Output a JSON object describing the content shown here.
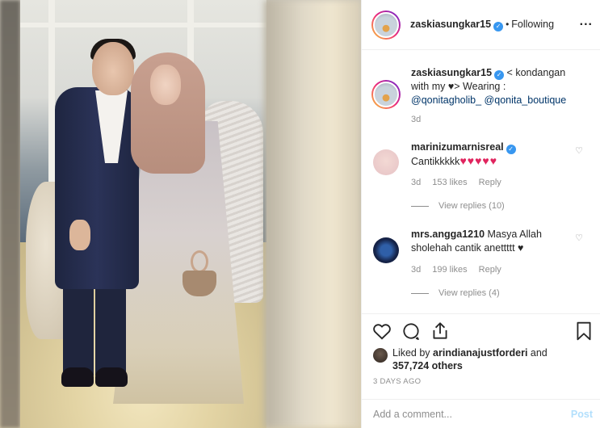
{
  "header": {
    "username": "zaskiasungkar15",
    "separator": "•",
    "follow_status": "Following",
    "more_label": "..."
  },
  "caption": {
    "username": "zaskiasungkar15",
    "text_before": "< kondangan with my ",
    "heart": "♥",
    "text_after": "> Wearing :",
    "mention1": "@qonitagholib_",
    "mention2": "@qonita_boutique",
    "time": "3d"
  },
  "comments": [
    {
      "username": "marinizumarnisreal",
      "verified": true,
      "text": "Cantikkkkk",
      "emoji": "♥♥♥♥♥",
      "time": "3d",
      "likes": "153 likes",
      "reply": "Reply",
      "view_replies": "View replies (10)"
    },
    {
      "username": "mrs.angga1210",
      "verified": false,
      "text": "Masya Allah sholehah cantik anettttt",
      "emoji": "♥",
      "time": "3d",
      "likes": "199 likes",
      "reply": "Reply",
      "view_replies": "View replies (4)"
    }
  ],
  "likes": {
    "prefix": "Liked by ",
    "user": "arindianajustforderi",
    "and": " and",
    "count": "357,724 others"
  },
  "timestamp": "3 DAYS AGO",
  "add_comment": {
    "placeholder": "Add a comment...",
    "post_label": "Post"
  },
  "icons": [
    "heart-icon",
    "comment-icon",
    "share-icon",
    "bookmark-icon",
    "verified-icon",
    "more-options-icon"
  ],
  "colors": {
    "verified": "#3897f0",
    "link": "#003569",
    "muted": "#8e8e8e",
    "post_disabled": "#b2dffc",
    "emoji_heart": "#e0245e"
  }
}
